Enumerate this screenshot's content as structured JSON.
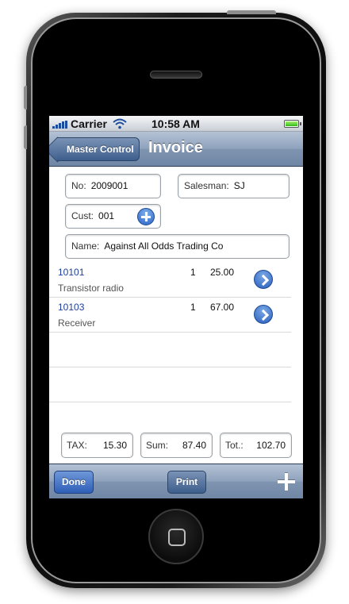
{
  "status_bar": {
    "carrier": "Carrier",
    "time": "10:58 AM",
    "signal_icon": "signal-bars-icon",
    "wifi_icon": "wifi-icon",
    "battery_icon": "battery-icon"
  },
  "nav": {
    "back_label": "Master Control",
    "title": "Invoice"
  },
  "form": {
    "no_label": "No:",
    "no_value": "2009001",
    "salesman_label": "Salesman:",
    "salesman_value": "SJ",
    "cust_label": "Cust:",
    "cust_value": "001",
    "name_label": "Name:",
    "name_value": "Against All Odds Trading Co"
  },
  "items": [
    {
      "code": "10101",
      "description": "Transistor radio",
      "qty": "1",
      "price": "25.00"
    },
    {
      "code": "10103",
      "description": "Receiver",
      "qty": "1",
      "price": "67.00"
    }
  ],
  "totals": {
    "tax_label": "TAX:",
    "tax_value": "15.30",
    "sum_label": "Sum:",
    "sum_value": "87.40",
    "total_label": "Tot.:",
    "total_value": "102.70"
  },
  "toolbar": {
    "done_label": "Done",
    "print_label": "Print"
  },
  "colors": {
    "bar_blue": "#7f94b0",
    "button_blue": "#3d5e8c",
    "link_blue": "#1d3f9a"
  }
}
